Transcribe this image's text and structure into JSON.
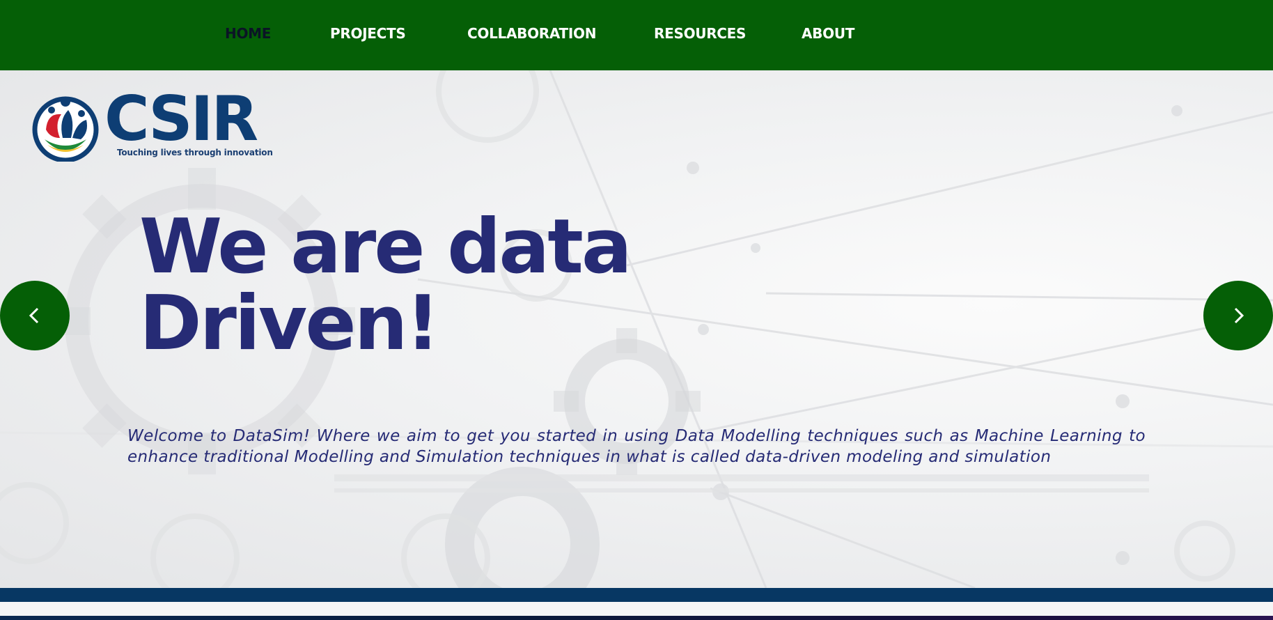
{
  "nav": {
    "items": [
      {
        "label": "HOME",
        "active": true
      },
      {
        "label": "PROJECTS",
        "active": false
      },
      {
        "label": "COLLABORATION",
        "active": false
      },
      {
        "label": "RESOURCES",
        "active": false
      },
      {
        "label": "ABOUT",
        "active": false
      }
    ]
  },
  "logo": {
    "wordmark": "CSIR",
    "tagline": "Touching lives through innovation"
  },
  "hero": {
    "headline_line1": "We are data",
    "headline_line2": "Driven!",
    "intro": "Welcome to DataSim! Where we aim to get you started in using Data Modelling techniques such as Machine Learning to enhance traditional Modelling and Simulation techniques in what is called data-driven modeling and simulation"
  },
  "carousel": {
    "prev_icon": "chevron-left-icon",
    "next_icon": "chevron-right-icon"
  },
  "colors": {
    "nav_background": "#055f06",
    "active_nav_text": "#0b1426",
    "headline": "#262b75",
    "logo_blue": "#0e3e74",
    "band": "#073763"
  }
}
